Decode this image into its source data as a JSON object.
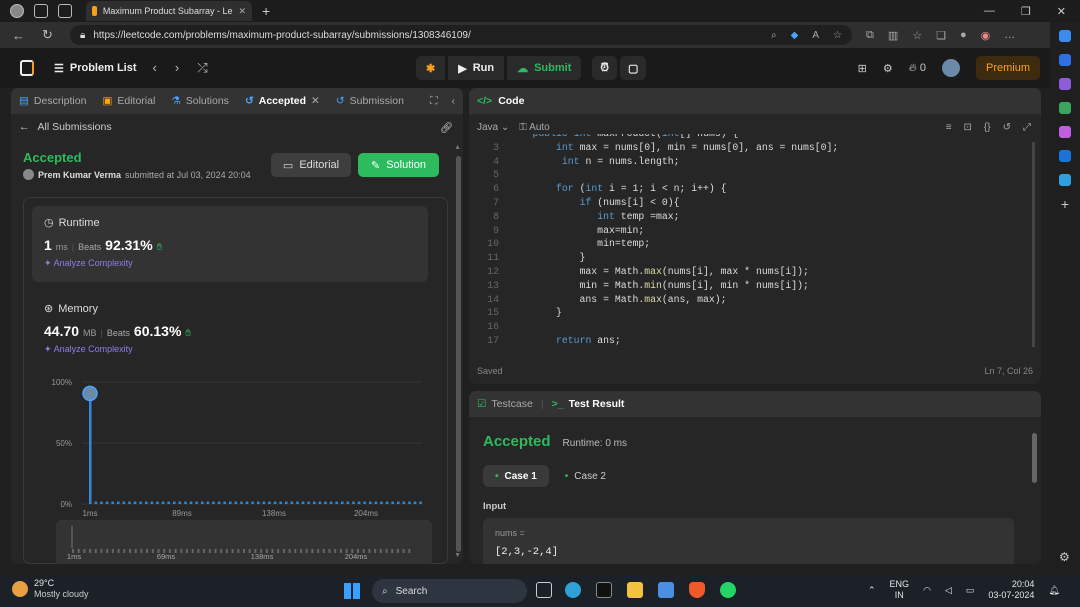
{
  "browser": {
    "tab_title": "Maximum Product Subarray - Le",
    "url": "https://leetcode.com/problems/maximum-product-subarray/submissions/1308346109/"
  },
  "header": {
    "problem_list": "Problem List",
    "run": "Run",
    "submit": "Submit",
    "streak": "0",
    "premium": "Premium"
  },
  "left_tabs": [
    "Description",
    "Editorial",
    "Solutions",
    "Accepted",
    "Submission"
  ],
  "submission": {
    "back": "All Submissions",
    "status": "Accepted",
    "author": "Prem Kumar Verma",
    "submitted": "submitted at Jul 03, 2024 20:04",
    "editorial_btn": "Editorial",
    "solution_btn": "Solution"
  },
  "runtime": {
    "label": "Runtime",
    "value": "1",
    "unit": "ms",
    "beats_label": "Beats",
    "beats": "92.31%",
    "analyze": "Analyze Complexity"
  },
  "memory": {
    "label": "Memory",
    "value": "44.70",
    "unit": "MB",
    "beats_label": "Beats",
    "beats": "60.13%",
    "analyze": "Analyze Complexity"
  },
  "chart_data": {
    "type": "bar",
    "ytick_labels": [
      "100%",
      "50%",
      "0%"
    ],
    "xtick_labels": [
      "1ms",
      "89ms",
      "138ms",
      "204ms"
    ],
    "mini_xtick_labels": [
      "1ms",
      "69ms",
      "138ms",
      "204ms"
    ],
    "highlight_x": "1ms",
    "highlight_value": 92.31,
    "baseline_value": 2
  },
  "code": {
    "title": "Code",
    "lang": "Java",
    "auto": "Auto",
    "status": "Saved",
    "cursor": "Ln 7, Col 26",
    "lines": [
      {
        "n": "",
        "t": "    public int maxProduct(int[] nums) {"
      },
      {
        "n": "3",
        "t": "        int max = nums[0], min = nums[0], ans = nums[0];"
      },
      {
        "n": "4",
        "t": "         int n = nums.length;"
      },
      {
        "n": "5",
        "t": ""
      },
      {
        "n": "6",
        "t": "        for (int i = 1; i < n; i++) {"
      },
      {
        "n": "7",
        "t": "            if (nums[i] < 0){"
      },
      {
        "n": "8",
        "t": "               int temp =max;"
      },
      {
        "n": "9",
        "t": "               max=min;"
      },
      {
        "n": "10",
        "t": "               min=temp;"
      },
      {
        "n": "11",
        "t": "            }"
      },
      {
        "n": "12",
        "t": "            max = Math.max(nums[i], max * nums[i]);"
      },
      {
        "n": "13",
        "t": "            min = Math.min(nums[i], min * nums[i]);"
      },
      {
        "n": "14",
        "t": "            ans = Math.max(ans, max);"
      },
      {
        "n": "15",
        "t": "        }"
      },
      {
        "n": "16",
        "t": ""
      },
      {
        "n": "17",
        "t": "        return ans;"
      }
    ]
  },
  "result": {
    "testcase": "Testcase",
    "tab": "Test Result",
    "status": "Accepted",
    "runtime": "Runtime: 0 ms",
    "case1": "Case 1",
    "case2": "Case 2",
    "input": "Input",
    "var": "nums =",
    "value": "[2,3,-2,4]"
  },
  "taskbar": {
    "temp": "29°C",
    "weather": "Mostly cloudy",
    "search": "Search",
    "lang1": "ENG",
    "lang2": "IN",
    "time": "20:04",
    "date": "03-07-2024"
  }
}
